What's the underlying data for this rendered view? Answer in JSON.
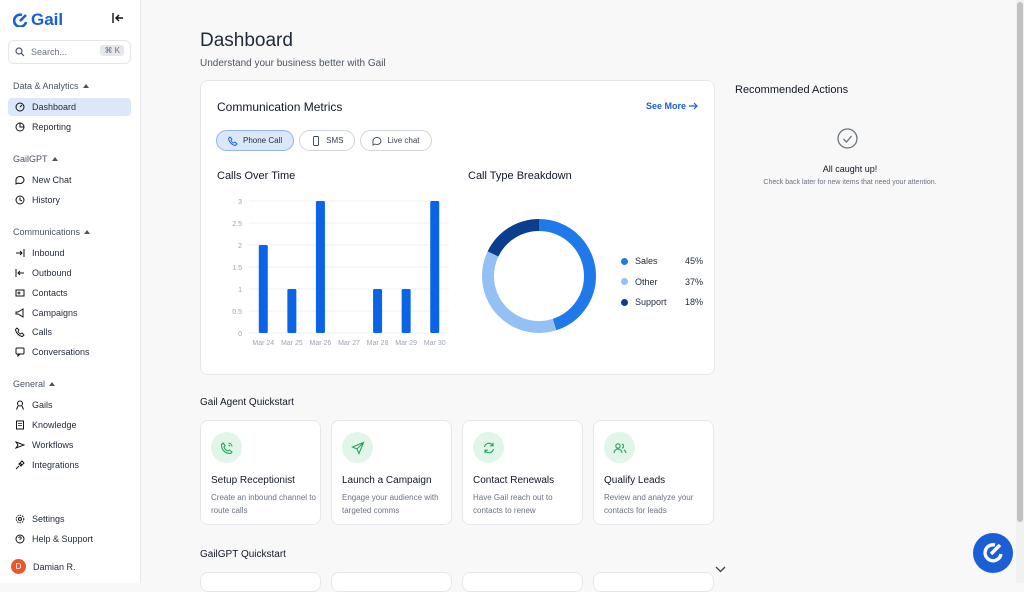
{
  "app": {
    "logo": "Gail"
  },
  "search": {
    "placeholder": "Search...",
    "shortcut": "⌘ K"
  },
  "sidebar": {
    "sections": [
      {
        "label": "Data & Analytics",
        "items": [
          {
            "label": "Dashboard",
            "icon": "gauge-icon",
            "active": true
          },
          {
            "label": "Reporting",
            "icon": "chart-icon"
          }
        ]
      },
      {
        "label": "GailGPT",
        "items": [
          {
            "label": "New Chat",
            "icon": "chat-icon"
          },
          {
            "label": "History",
            "icon": "clock-icon"
          }
        ]
      },
      {
        "label": "Communications",
        "items": [
          {
            "label": "Inbound",
            "icon": "arrow-in-icon"
          },
          {
            "label": "Outbound",
            "icon": "arrow-out-icon"
          },
          {
            "label": "Contacts",
            "icon": "contacts-icon"
          },
          {
            "label": "Campaigns",
            "icon": "megaphone-icon"
          },
          {
            "label": "Calls",
            "icon": "phone-icon"
          },
          {
            "label": "Conversations",
            "icon": "conversation-icon"
          }
        ]
      },
      {
        "label": "General",
        "items": [
          {
            "label": "Gails",
            "icon": "agent-icon"
          },
          {
            "label": "Knowledge",
            "icon": "book-icon"
          },
          {
            "label": "Workflows",
            "icon": "workflow-icon"
          },
          {
            "label": "Integrations",
            "icon": "plug-icon"
          }
        ]
      }
    ],
    "footer": [
      {
        "label": "Settings",
        "icon": "gear-icon"
      },
      {
        "label": "Help & Support",
        "icon": "help-icon"
      }
    ],
    "user": {
      "initial": "D",
      "name": "Damian R."
    }
  },
  "header": {
    "title": "Dashboard",
    "subtitle": "Understand your business better with Gail"
  },
  "metrics": {
    "title": "Communication Metrics",
    "see_more": "See More",
    "tabs": [
      {
        "label": "Phone Call",
        "active": true
      },
      {
        "label": "SMS"
      },
      {
        "label": "Live chat"
      }
    ]
  },
  "chart_data": [
    {
      "type": "bar",
      "title": "Calls Over Time",
      "categories": [
        "Mar 24",
        "Mar 25",
        "Mar 26",
        "Mar 27",
        "Mar 28",
        "Mar 29",
        "Mar 30"
      ],
      "values": [
        2,
        1,
        3,
        0,
        1,
        1,
        3
      ],
      "yticks": [
        "0",
        "0.5",
        "1",
        "1.5",
        "2",
        "2.5",
        "3"
      ],
      "ylim": [
        0,
        3
      ],
      "grid": true,
      "color": "#0b63e5"
    },
    {
      "type": "pie",
      "title": "Call Type Breakdown",
      "donut": true,
      "legend_position": "right",
      "slices": [
        {
          "name": "Sales",
          "value": 45,
          "label": "45%",
          "color": "#2079e8"
        },
        {
          "name": "Other",
          "value": 37,
          "label": "37%",
          "color": "#94c1f5"
        },
        {
          "name": "Support",
          "value": 18,
          "label": "18%",
          "color": "#0b3e8c"
        }
      ]
    }
  ],
  "recommended": {
    "title": "Recommended Actions",
    "status": "All caught up!",
    "message": "Check back later for new items that need your attention."
  },
  "agent_quickstart": {
    "title": "Gail Agent Quickstart",
    "cards": [
      {
        "title": "Setup Receptionist",
        "desc": "Create an inbound channel to route calls",
        "icon": "phone-ring-icon"
      },
      {
        "title": "Launch a Campaign",
        "desc": "Engage your audience with targeted comms",
        "icon": "send-icon"
      },
      {
        "title": "Contact Renewals",
        "desc": "Have Gail reach out to contacts to renew",
        "icon": "refresh-icon"
      },
      {
        "title": "Qualify Leads",
        "desc": "Review and analyze your contacts for leads",
        "icon": "users-icon"
      }
    ]
  },
  "gpt_quickstart": {
    "title": "GailGPT Quickstart"
  }
}
